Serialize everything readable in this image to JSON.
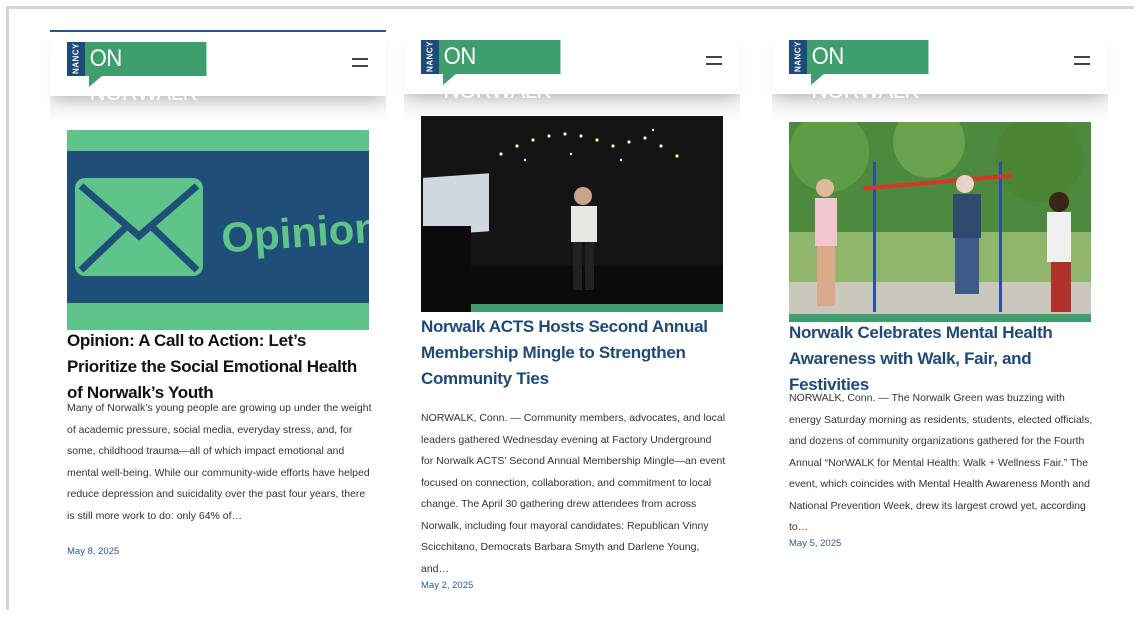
{
  "logo": {
    "small_text": "NANCY",
    "main_text": "ON NORWALK"
  },
  "articles": [
    {
      "thumb_text": "Opinion",
      "title": "Opinion: A Call to Action: Let’s Prioritize the Social Emotional Health of Norwalk’s Youth",
      "title_color": "#111111",
      "excerpt": "Many of Norwalk’s young people are growing up under the weight of academic pressure, social media, everyday stress, and, for some, childhood trauma—all of which impact emotional and mental well-being. While our community-wide efforts have helped reduce depression and suicidality over the past four years, there is still more work to do: only 64% of…",
      "date": "May 8, 2025"
    },
    {
      "title": "Norwalk ACTS Hosts Second Annual Membership Mingle to Strengthen Community Ties",
      "title_color": "#1e4a7a",
      "excerpt": "NORWALK, Conn. — Community members, advocates, and local leaders gathered Wednesday evening at Factory Underground for Norwalk ACTS’ Second Annual Membership Mingle—an event focused on connection, collaboration, and commitment to local change. The April 30 gathering drew attendees from across Norwalk, including four mayoral candidates: Republican Vinny Scicchitano, Democrats Barbara Smyth and Darlene Young, and…",
      "date": "May 2, 2025"
    },
    {
      "title": "Norwalk Celebrates Mental Health Awareness with Walk, Fair, and Festivities",
      "title_color": "#1e4a7a",
      "excerpt": "NORWALK, Conn. — The Norwalk Green was buzzing with energy Saturday morning as residents, students, elected officials, and dozens of community organizations gathered for the Fourth Annual “NorWALK for Mental Health: Walk + Wellness Fair.” The event, which coincides with Mental Health Awareness Month and National Prevention Week, drew its largest crowd yet, according to…",
      "date": "May 5, 2025"
    }
  ],
  "colors": {
    "brand_green": "#3f9e6e",
    "brand_blue": "#1e4a7a",
    "opinion_bg": "#1f4f78",
    "opinion_green": "#5ec48a"
  },
  "icons": {
    "menu": "hamburger-menu-icon",
    "envelope": "envelope-icon"
  }
}
